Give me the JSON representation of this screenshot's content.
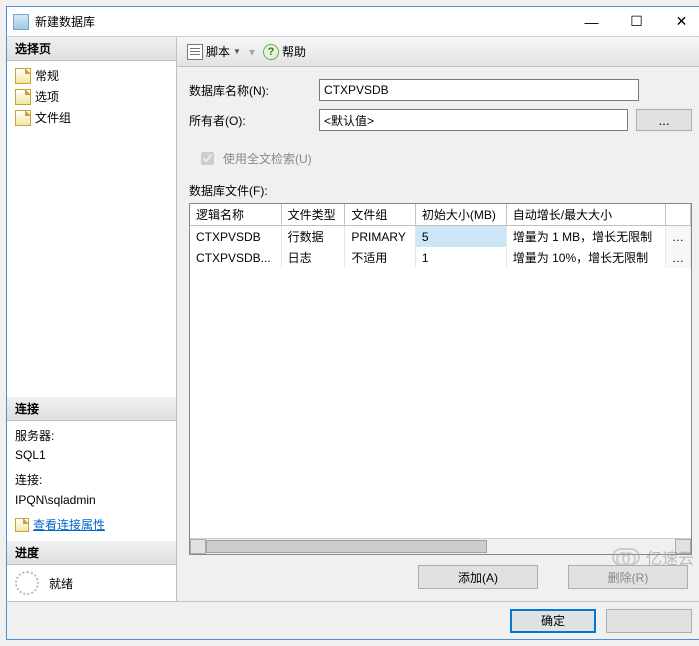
{
  "window": {
    "title": "新建数据库"
  },
  "sidebar": {
    "select_header": "选择页",
    "items": [
      {
        "label": "常规"
      },
      {
        "label": "选项"
      },
      {
        "label": "文件组"
      }
    ],
    "connection": {
      "header": "连接",
      "server_label": "服务器:",
      "server_value": "SQL1",
      "conn_label": "连接:",
      "conn_value": "IPQN\\sqladmin",
      "view_link": "查看连接属性"
    },
    "progress": {
      "header": "进度",
      "status": "就绪"
    }
  },
  "toolbar": {
    "script": "脚本",
    "help": "帮助"
  },
  "form": {
    "dbname_label": "数据库名称(N):",
    "dbname_value": "CTXPVSDB",
    "owner_label": "所有者(O):",
    "owner_value": "<默认值>",
    "fulltext_label": "使用全文检索(U)",
    "files_label": "数据库文件(F):",
    "ell": "..."
  },
  "grid": {
    "headers": [
      "逻辑名称",
      "文件类型",
      "文件组",
      "初始大小(MB)",
      "自动增长/最大大小"
    ],
    "rows": [
      {
        "name": "CTXPVSDB",
        "type": "行数据",
        "group": "PRIMARY",
        "size": "5",
        "growth": "增量为 1 MB，增长无限制",
        "size_selected": true
      },
      {
        "name": "CTXPVSDB...",
        "type": "日志",
        "group": "不适用",
        "size": "1",
        "growth": "增量为 10%，增长无限制",
        "size_selected": false
      }
    ]
  },
  "actions": {
    "add": "添加(A)",
    "remove": "删除(R)"
  },
  "footer": {
    "ok": "确定"
  },
  "watermark": "亿速云"
}
